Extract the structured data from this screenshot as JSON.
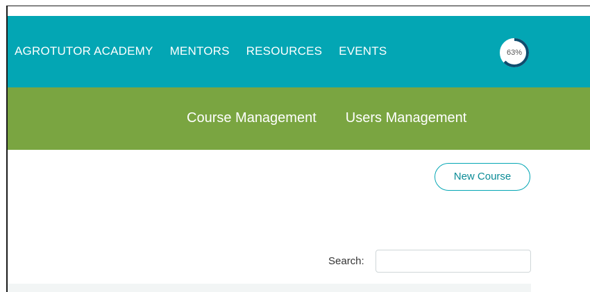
{
  "top_nav": {
    "items": [
      {
        "label": "AGROTUTOR ACADEMY"
      },
      {
        "label": "MENTORS"
      },
      {
        "label": "RESOURCES"
      },
      {
        "label": "EVENTS"
      }
    ],
    "progress": {
      "label": "63%",
      "value": 0.63,
      "color": "#0f4d6e",
      "track_color": "#ffffff"
    },
    "background_color": "#03a6b4"
  },
  "sub_nav": {
    "items": [
      {
        "label": "Course Management"
      },
      {
        "label": "Users Management"
      }
    ],
    "background_color": "#7aa541"
  },
  "main": {
    "new_course_label": "New Course",
    "search_label": "Search:",
    "search_value": ""
  }
}
